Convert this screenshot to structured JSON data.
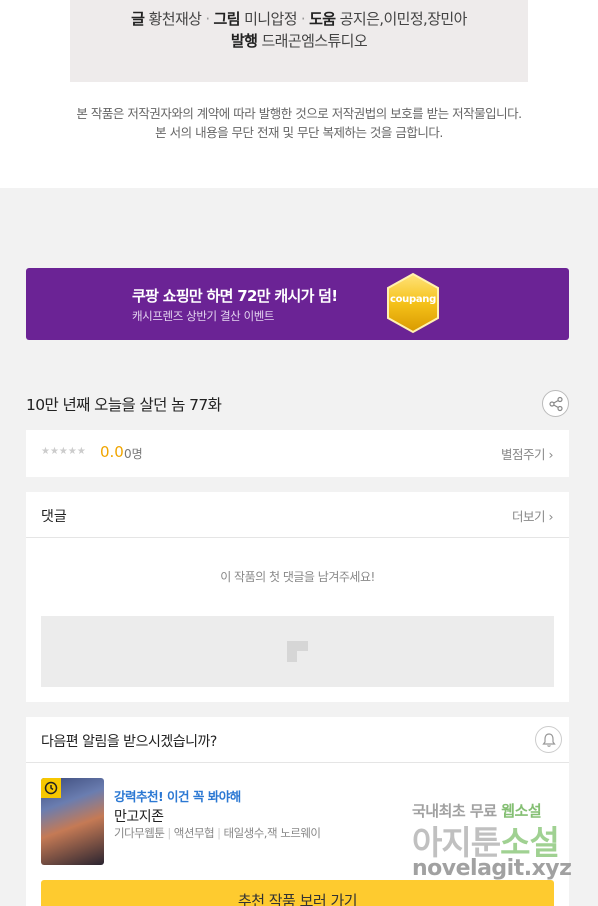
{
  "credits": {
    "writer_label": "글",
    "writer": "황천재상",
    "art_label": "그림",
    "art": "미니압정",
    "assist_label": "도움",
    "assist": "공지은,이민정,장민아",
    "publisher_label": "발행",
    "publisher": "드래곤엠스튜디오",
    "separator": "·"
  },
  "notice": {
    "line1": "본 작품은 저작권자와의 계약에 따라 발행한 것으로 저작권법의 보호를 받는 저작물입니다.",
    "line2": "본 서의 내용을 무단 전재 및 무단 복제하는 것을 금합니다."
  },
  "banner": {
    "title": "쿠팡 쇼핑만 하면 72만 캐시가 덤!",
    "subtitle": "캐시프렌즈 상반기 결산 이벤트",
    "badge_text": "coupang",
    "color": "#6b2395"
  },
  "episode": {
    "title": "10만 년째 오늘을 살던 놈 77화",
    "share_icon": "share-icon"
  },
  "rating": {
    "stars": "★★★★★",
    "score": "0.0",
    "count": "0명",
    "rate_link": "별점주기 ›",
    "score_color": "#f0a500"
  },
  "comments": {
    "title": "댓글",
    "more_link": "더보기 ›",
    "empty_message": "이 작품의 첫 댓글을 남겨주세요!"
  },
  "notify": {
    "question": "다음편 알림을 받으시겠습니까?",
    "bell_icon": "bell-icon"
  },
  "recommendation": {
    "tag": "강력추천! 이건 꼭 봐야해",
    "title": "만고지존",
    "meta": [
      "기다무웹툰",
      "액션무협",
      "태일생수,잭 노르웨이"
    ],
    "cta": "추천 작품 보러 가기",
    "cta_color": "#fecb2f",
    "tag_color": "#2b78d3"
  },
  "watermark": {
    "line1_a": "국내최초 무료 ",
    "line1_b": "웹소설",
    "line2_a": "아지툰",
    "line2_b": "소설",
    "line3": "novelagit.xyz"
  }
}
